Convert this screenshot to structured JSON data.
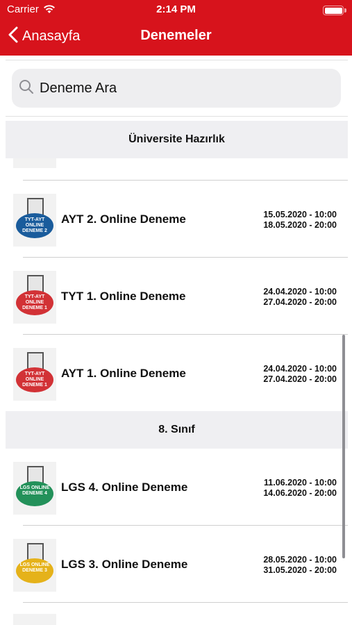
{
  "status_bar": {
    "carrier": "Carrier",
    "time": "2:14 PM"
  },
  "nav": {
    "back_label": "Anasayfa",
    "title": "Denemeler"
  },
  "search": {
    "value": "Deneme Ara"
  },
  "sections": [
    {
      "title": "Üniversite Hazırlık",
      "items": [
        {
          "title": "AYT 2. Online Deneme",
          "start": "15.05.2020 - 10:00",
          "end": "18.05.2020 - 20:00",
          "badge_color": "#1a5c9c",
          "badge_text": "TYT-AYT ONLINE DENEME 2"
        },
        {
          "title": "TYT 1. Online Deneme",
          "start": "24.04.2020 - 10:00",
          "end": "27.04.2020 - 20:00",
          "badge_color": "#d23236",
          "badge_text": "TYT-AYT ONLINE DENEME 1"
        },
        {
          "title": "AYT 1. Online Deneme",
          "start": "24.04.2020 - 10:00",
          "end": "27.04.2020 - 20:00",
          "badge_color": "#d23236",
          "badge_text": "TYT-AYT ONLINE DENEME 1"
        }
      ]
    },
    {
      "title": "8. Sınıf",
      "items": [
        {
          "title": "LGS 4. Online Deneme",
          "start": "11.06.2020 - 10:00",
          "end": "14.06.2020 - 20:00",
          "badge_color": "#23915a",
          "badge_text": "LGS ONLINE DENEME 4"
        },
        {
          "title": "LGS 3. Online Deneme",
          "start": "28.05.2020 - 10:00",
          "end": "31.05.2020 - 20:00",
          "badge_color": "#e5b21a",
          "badge_text": "LGS ONLINE DENEME 3"
        }
      ]
    }
  ],
  "colors": {
    "accent": "#d7131c"
  }
}
